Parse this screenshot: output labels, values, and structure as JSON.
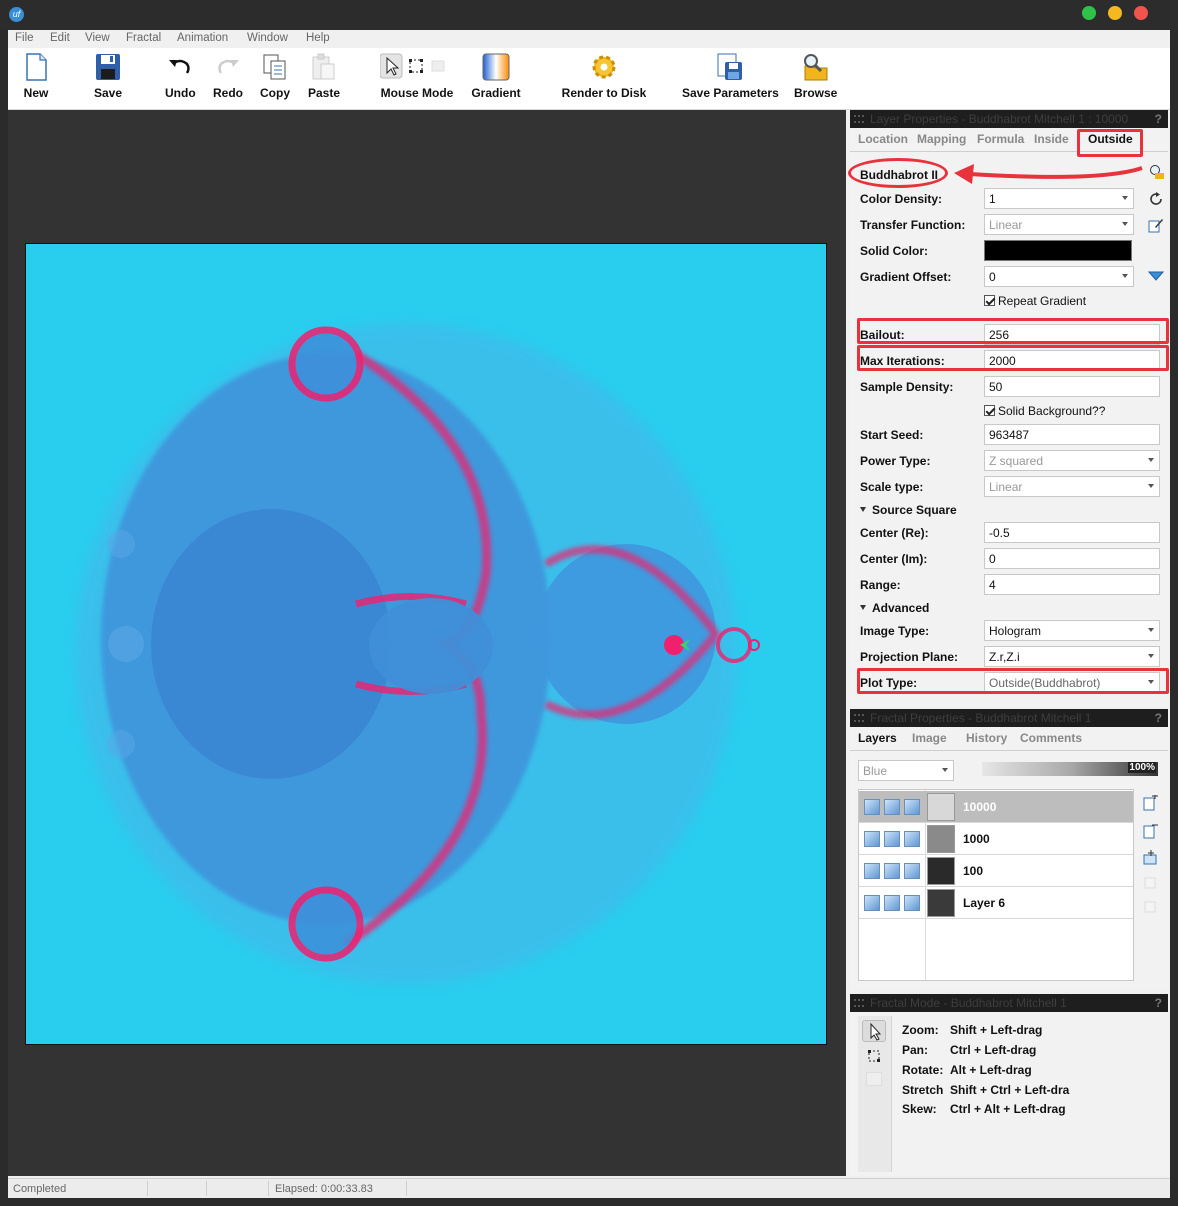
{
  "window": {
    "title": ""
  },
  "menu": [
    "File",
    "Edit",
    "View",
    "Fractal",
    "Animation",
    "Window",
    "Help"
  ],
  "toolbar": {
    "new": "New",
    "save": "Save",
    "undo": "Undo",
    "redo": "Redo",
    "copy": "Copy",
    "paste": "Paste",
    "mouse_mode": "Mouse Mode",
    "gradient": "Gradient",
    "render": "Render to Disk",
    "save_params": "Save Parameters",
    "browse": "Browse"
  },
  "layer_panel": {
    "header": "Layer Properties - Buddhabrot Mitchell 1 : 10000",
    "tabs": [
      "Location",
      "Mapping",
      "Formula",
      "Inside",
      "Outside"
    ],
    "active_tab": "Outside",
    "coloring_name": "Buddhabrot II",
    "color_density": {
      "label": "Color Density:",
      "value": "1"
    },
    "transfer_function": {
      "label": "Transfer Function:",
      "value": "Linear"
    },
    "solid_color": {
      "label": "Solid Color:",
      "value": "#000000"
    },
    "gradient_offset": {
      "label": "Gradient Offset:",
      "value": "0"
    },
    "repeat_gradient": "Repeat Gradient",
    "bailout": {
      "label": "Bailout:",
      "value": "256"
    },
    "max_iterations": {
      "label": "Max Iterations:",
      "value": "2000"
    },
    "sample_density": {
      "label": "Sample Density:",
      "value": "50"
    },
    "solid_background": "Solid Background??",
    "start_seed": {
      "label": "Start Seed:",
      "value": "963487"
    },
    "power_type": {
      "label": "Power Type:",
      "value": "Z squared"
    },
    "scale_type": {
      "label": "Scale type:",
      "value": "Linear"
    },
    "source_square": "Source Square",
    "center_re": {
      "label": "Center (Re):",
      "value": "-0.5"
    },
    "center_im": {
      "label": "Center (Im):",
      "value": "0"
    },
    "range": {
      "label": "Range:",
      "value": "4"
    },
    "advanced": "Advanced",
    "image_type": {
      "label": "Image Type:",
      "value": "Hologram"
    },
    "projection_plane": {
      "label": "Projection Plane:",
      "value": "Z.r,Z.i"
    },
    "plot_type": {
      "label": "Plot Type:",
      "value": "Outside(Buddhabrot)"
    }
  },
  "fractal_panel": {
    "header": "Fractal Properties - Buddhabrot Mitchell 1",
    "tabs": [
      "Layers",
      "Image",
      "History",
      "Comments"
    ],
    "active_tab": "Layers",
    "blend_mode": "Blue",
    "opacity": "100%",
    "layers": [
      {
        "name": "10000",
        "selected": true
      },
      {
        "name": "1000",
        "selected": false
      },
      {
        "name": "100",
        "selected": false
      },
      {
        "name": "Layer 6",
        "selected": false
      }
    ]
  },
  "mode_panel": {
    "header": "Fractal Mode - Buddhabrot Mitchell 1",
    "rows": [
      {
        "k": "Zoom:",
        "v": "Shift + Left-drag"
      },
      {
        "k": "Pan:",
        "v": "Ctrl + Left-drag"
      },
      {
        "k": "Rotate:",
        "v": "Alt + Left-drag"
      },
      {
        "k": "Stretch",
        "v": "Shift + Ctrl + Left-dra"
      },
      {
        "k": "Skew:",
        "v": "Ctrl + Alt + Left-drag"
      }
    ]
  },
  "status": {
    "left": "Completed",
    "elapsed": "Elapsed: 0:00:33.83"
  },
  "colors": {
    "accent": "#e8323c",
    "fractal_bg": "#29cdee",
    "fractal_body": "#3d8fd9",
    "fractal_edge": "#f0206e"
  }
}
